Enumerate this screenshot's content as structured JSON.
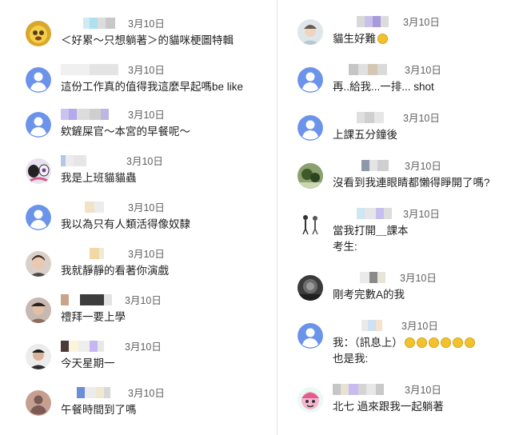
{
  "comments_left": [
    {
      "date": "3月10日",
      "text": "＜好累～只想躺著＞的貓咪梗圖特輯",
      "avatar": "cartoon-avatar"
    },
    {
      "date": "3月10日",
      "text": "這份工作真的值得我這麼早起嗎be like",
      "avatar": "default-avatar"
    },
    {
      "date": "3月10日",
      "text": "欸鏟屎官～本宮的早餐呢～",
      "avatar": "default-avatar"
    },
    {
      "date": "3月10日",
      "text": "我是上班貓貓蟲",
      "avatar": "cartoon-avatar"
    },
    {
      "date": "3月10日",
      "text": "我以為只有人類活得像奴隸",
      "avatar": "default-avatar"
    },
    {
      "date": "3月10日",
      "text": "我就靜靜的看著你演戲",
      "avatar": "photo-avatar"
    },
    {
      "date": "3月10日",
      "text": "禮拜一要上學",
      "avatar": "photo-avatar"
    },
    {
      "date": "3月10日",
      "text": "今天星期一",
      "avatar": "photo-avatar"
    },
    {
      "date": "3月10日",
      "text": "午餐時間到了嗎",
      "avatar": "silhouette-avatar"
    }
  ],
  "comments_right": [
    {
      "date": "3月10日",
      "text": "貓生好難",
      "avatar": "photo-avatar"
    },
    {
      "date": "3月10日",
      "text": "再..給我...一排... shot",
      "avatar": "default-avatar"
    },
    {
      "date": "3月10日",
      "text": "上課五分鐘後",
      "avatar": "default-avatar"
    },
    {
      "date": "3月10日",
      "text": "沒看到我連眼睛都懶得睜開了嗎?",
      "avatar": "photo-avatar"
    },
    {
      "date": "3月10日",
      "text": "當我打開＿課本",
      "text2": "考生:",
      "avatar": "drawing-avatar"
    },
    {
      "date": "3月10日",
      "text": "剛考完數A的我",
      "avatar": "photo-avatar"
    },
    {
      "date": "3月10日",
      "text": "我：（訊息上）",
      "text2": "也是我:",
      "avatar": "default-avatar"
    },
    {
      "date": "3月10日",
      "text": "北七 過來跟我一起躺著",
      "avatar": "cartoon-avatar"
    }
  ]
}
